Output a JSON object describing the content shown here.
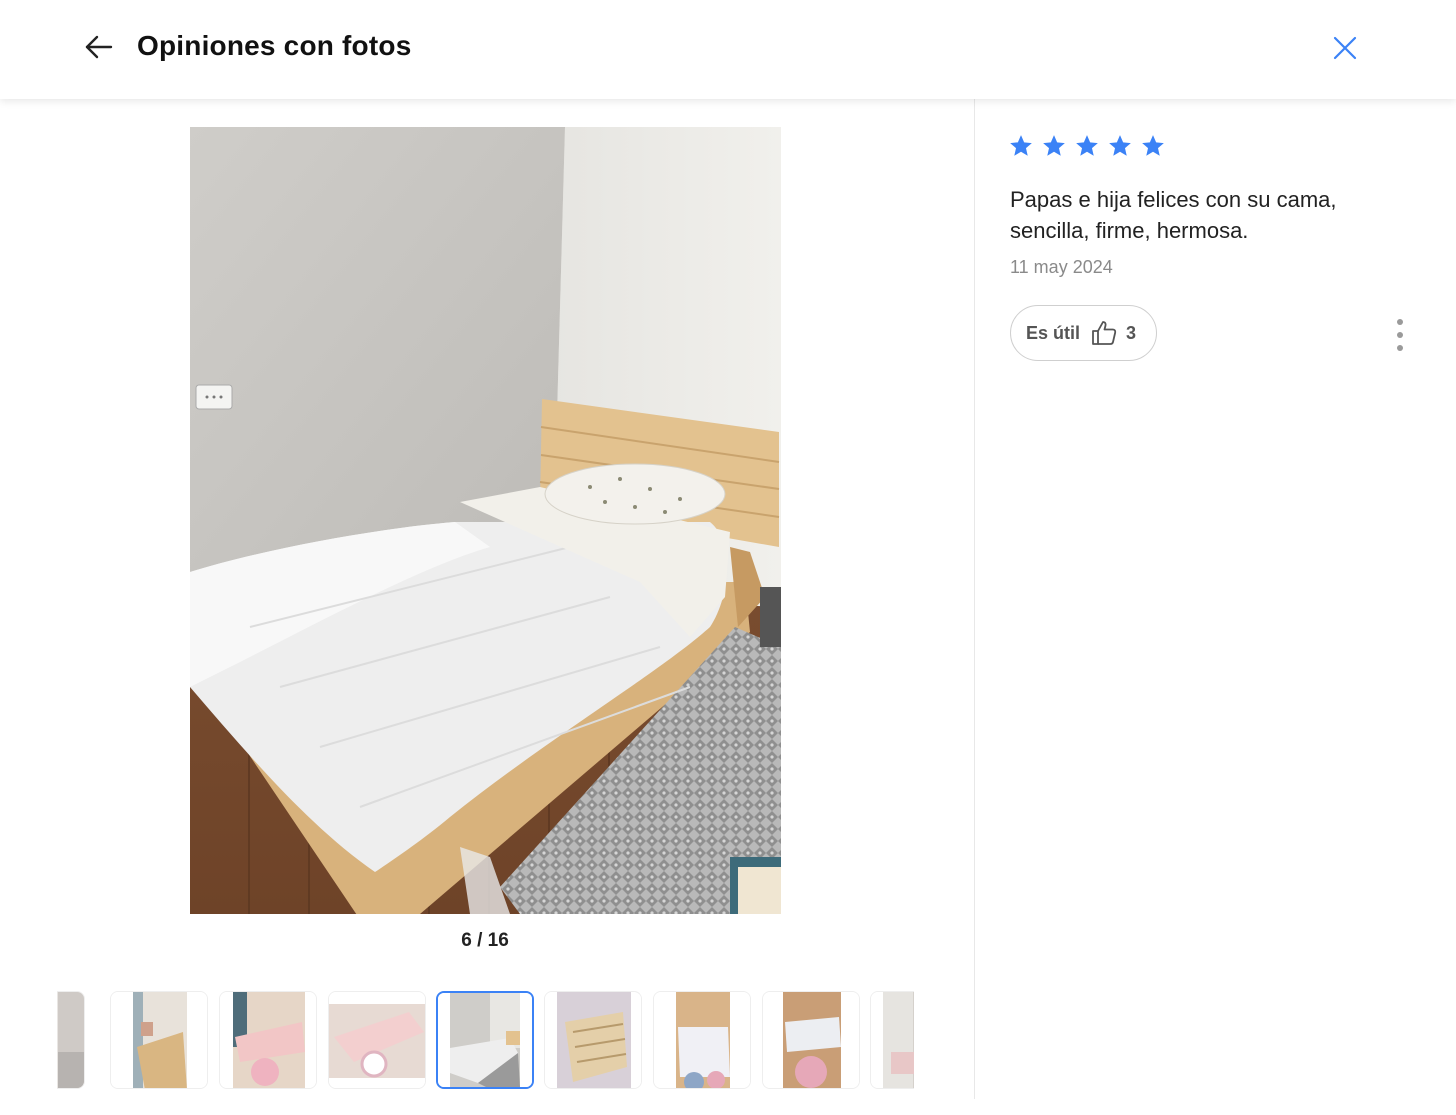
{
  "header": {
    "title": "Opiniones con fotos",
    "back_icon": "arrow-left-icon",
    "close_icon": "close-icon"
  },
  "gallery": {
    "counter": "6 / 16",
    "current_index": 6,
    "total": 16,
    "thumbnail_count": 9
  },
  "review": {
    "rating": 5,
    "text": "Papas e hija felices con su cama, sencilla, firme, hermosa.",
    "date": "11 may 2024",
    "useful_label": "Es útil",
    "useful_count": "3",
    "useful_icon": "thumbs-up-icon",
    "more_icon": "more-vertical-icon"
  },
  "colors": {
    "accent": "#3b82f6",
    "star": "#3b82f6"
  }
}
